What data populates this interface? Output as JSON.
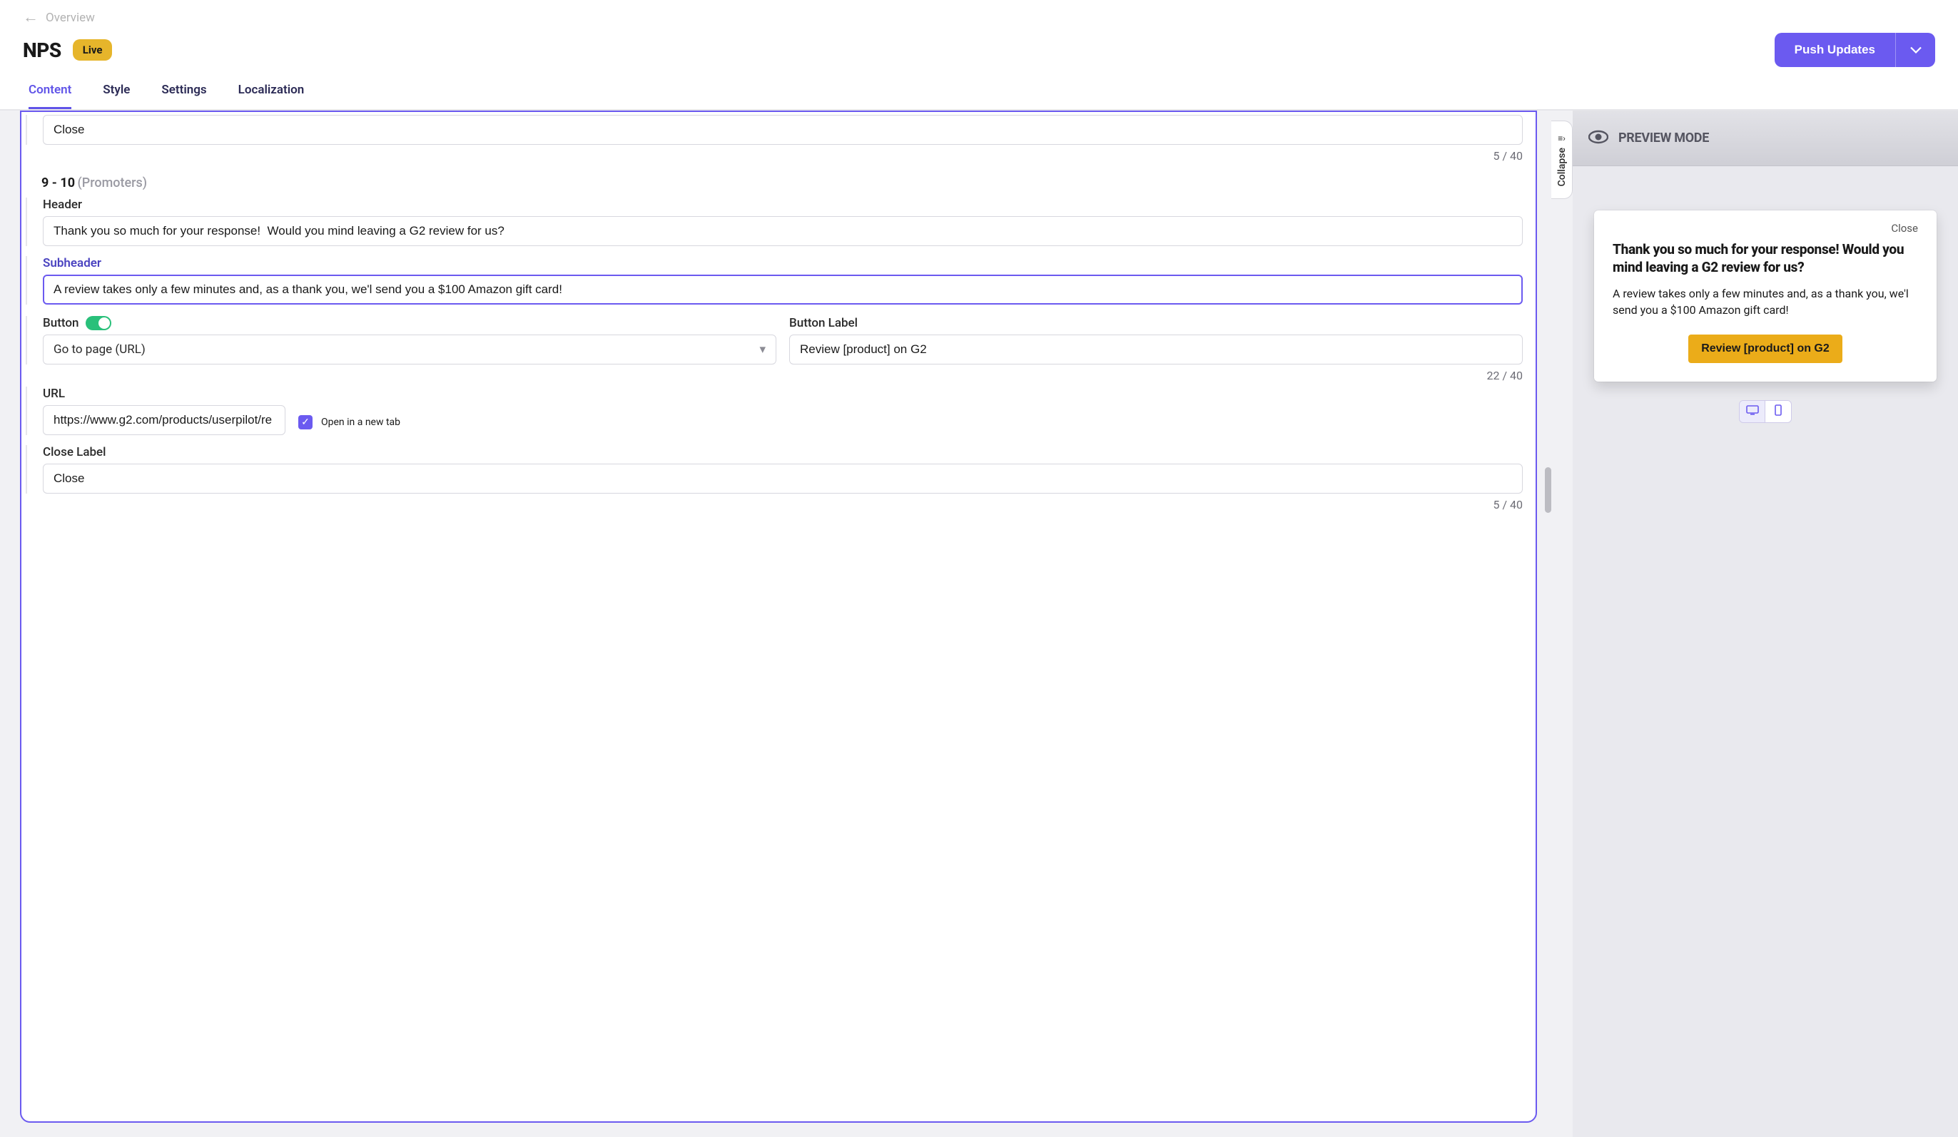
{
  "breadcrumb": {
    "back_label": "Overview"
  },
  "header": {
    "title": "NPS",
    "status": "Live",
    "push_label": "Push Updates"
  },
  "tabs": [
    {
      "label": "Content",
      "active": true
    },
    {
      "label": "Style",
      "active": false
    },
    {
      "label": "Settings",
      "active": false
    },
    {
      "label": "Localization",
      "active": false
    }
  ],
  "editor": {
    "top_close_block": {
      "value": "Close",
      "counter": "5 / 40"
    },
    "section": {
      "range_label": "9 - 10",
      "range_parenthetical": "(Promoters)",
      "header_label": "Header",
      "header_value": "Thank you so much for your response!  Would you mind leaving a G2 review for us?",
      "subheader_label": "Subheader",
      "subheader_value": "A review takes only a few minutes and, as a thank you, we'l send you a $100 Amazon gift card!",
      "button_toggle_label": "Button",
      "button_toggle_on": true,
      "button_action_label": "Go to page (URL)",
      "button_label_label": "Button Label",
      "button_label_value": "Review [product] on G2",
      "button_label_counter": "22 / 40",
      "url_label": "URL",
      "url_value": "https://www.g2.com/products/userpilot/re",
      "open_new_tab_label": "Open in a new tab",
      "open_new_tab_checked": true,
      "close_label_label": "Close Label",
      "close_label_value": "Close",
      "close_label_counter": "5 / 40"
    },
    "collapse_label": "Collapse"
  },
  "preview": {
    "mode_label": "PREVIEW MODE",
    "card": {
      "close": "Close",
      "header": "Thank you so much for your response! Would you mind leaving a G2 review for us?",
      "subheader": "A review takes only a few minutes and, as a thank you, we'l send you a $100 Amazon gift card!",
      "cta": "Review [product] on G2"
    }
  }
}
